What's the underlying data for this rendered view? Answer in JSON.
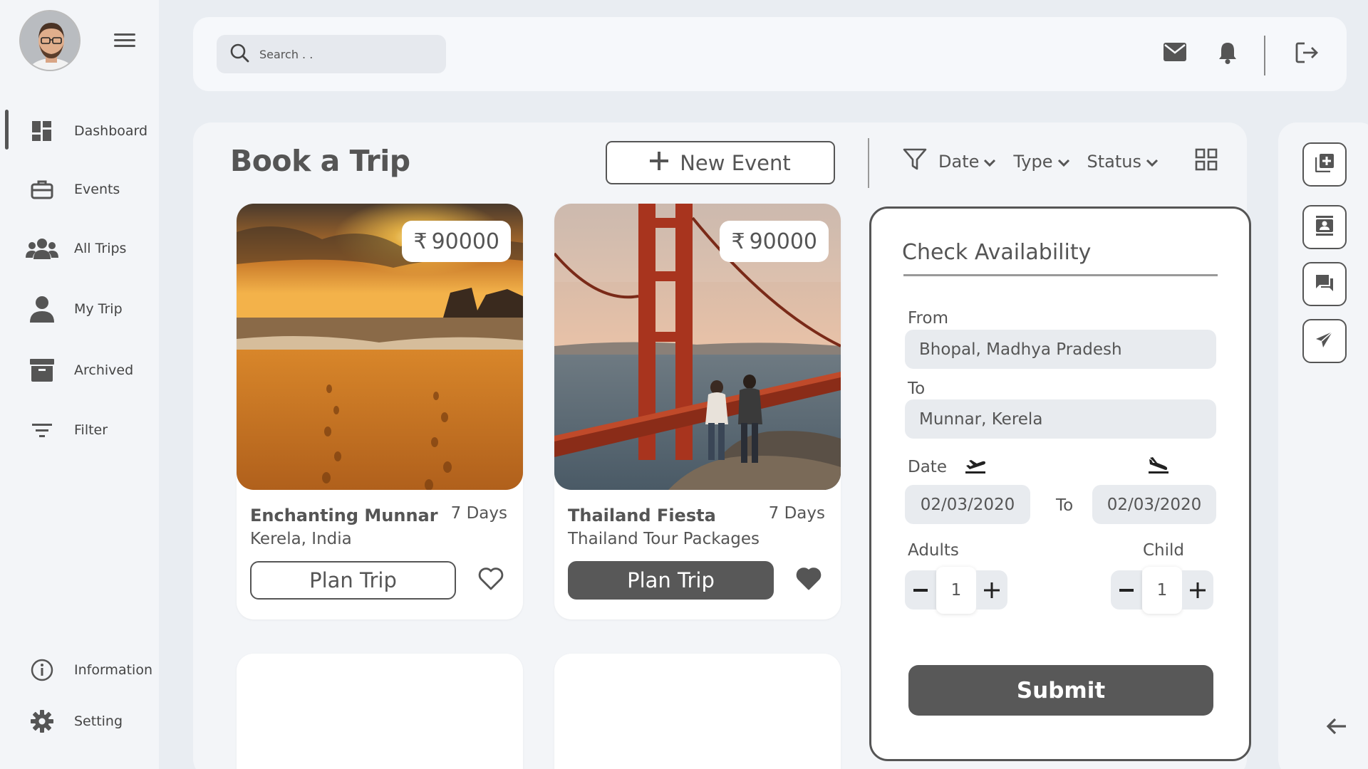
{
  "user": {
    "avatar_alt": "User avatar"
  },
  "sidebar": {
    "items": [
      {
        "label": "Dashboard",
        "icon": "dashboard-icon",
        "active": true
      },
      {
        "label": "Events",
        "icon": "briefcase-icon"
      },
      {
        "label": "All Trips",
        "icon": "group-icon"
      },
      {
        "label": "My Trip",
        "icon": "person-icon"
      },
      {
        "label": "Archived",
        "icon": "archive-icon"
      },
      {
        "label": "Filter",
        "icon": "filter-lines-icon"
      }
    ],
    "bottom": [
      {
        "label": "Information",
        "icon": "info-icon"
      },
      {
        "label": "Setting",
        "icon": "gear-icon"
      }
    ]
  },
  "topbar": {
    "search_placeholder": "Search . ."
  },
  "main": {
    "title": "Book a Trip",
    "new_event_label": "New Event",
    "filters": {
      "date": "Date",
      "type": "Type",
      "status": "Status"
    }
  },
  "cards": [
    {
      "price": "90000",
      "currency": "₹",
      "title": "Enchanting Munnar",
      "days": "7 Days",
      "subtitle": "Kerela, India",
      "button": "Plan Trip",
      "favorited": false
    },
    {
      "price": "90000",
      "currency": "₹",
      "title": "Thailand Fiesta",
      "days": "7 Days",
      "subtitle": "Thailand Tour Packages",
      "button": "Plan Trip",
      "favorited": true
    }
  ],
  "availability": {
    "title": "Check Availability",
    "from_label": "From",
    "from_value": "Bhopal, Madhya Pradesh",
    "to_label": "To",
    "to_value": "Munnar, Kerela",
    "date_label": "Date",
    "date_from": "02/03/2020",
    "date_to_label": "To",
    "date_to": "02/03/2020",
    "adults_label": "Adults",
    "adults_value": "1",
    "child_label": "Child",
    "child_value": "1",
    "submit_label": "Submit"
  },
  "colors": {
    "accent": "#585858",
    "background": "#e9edf2",
    "panel": "#f3f5f8"
  }
}
